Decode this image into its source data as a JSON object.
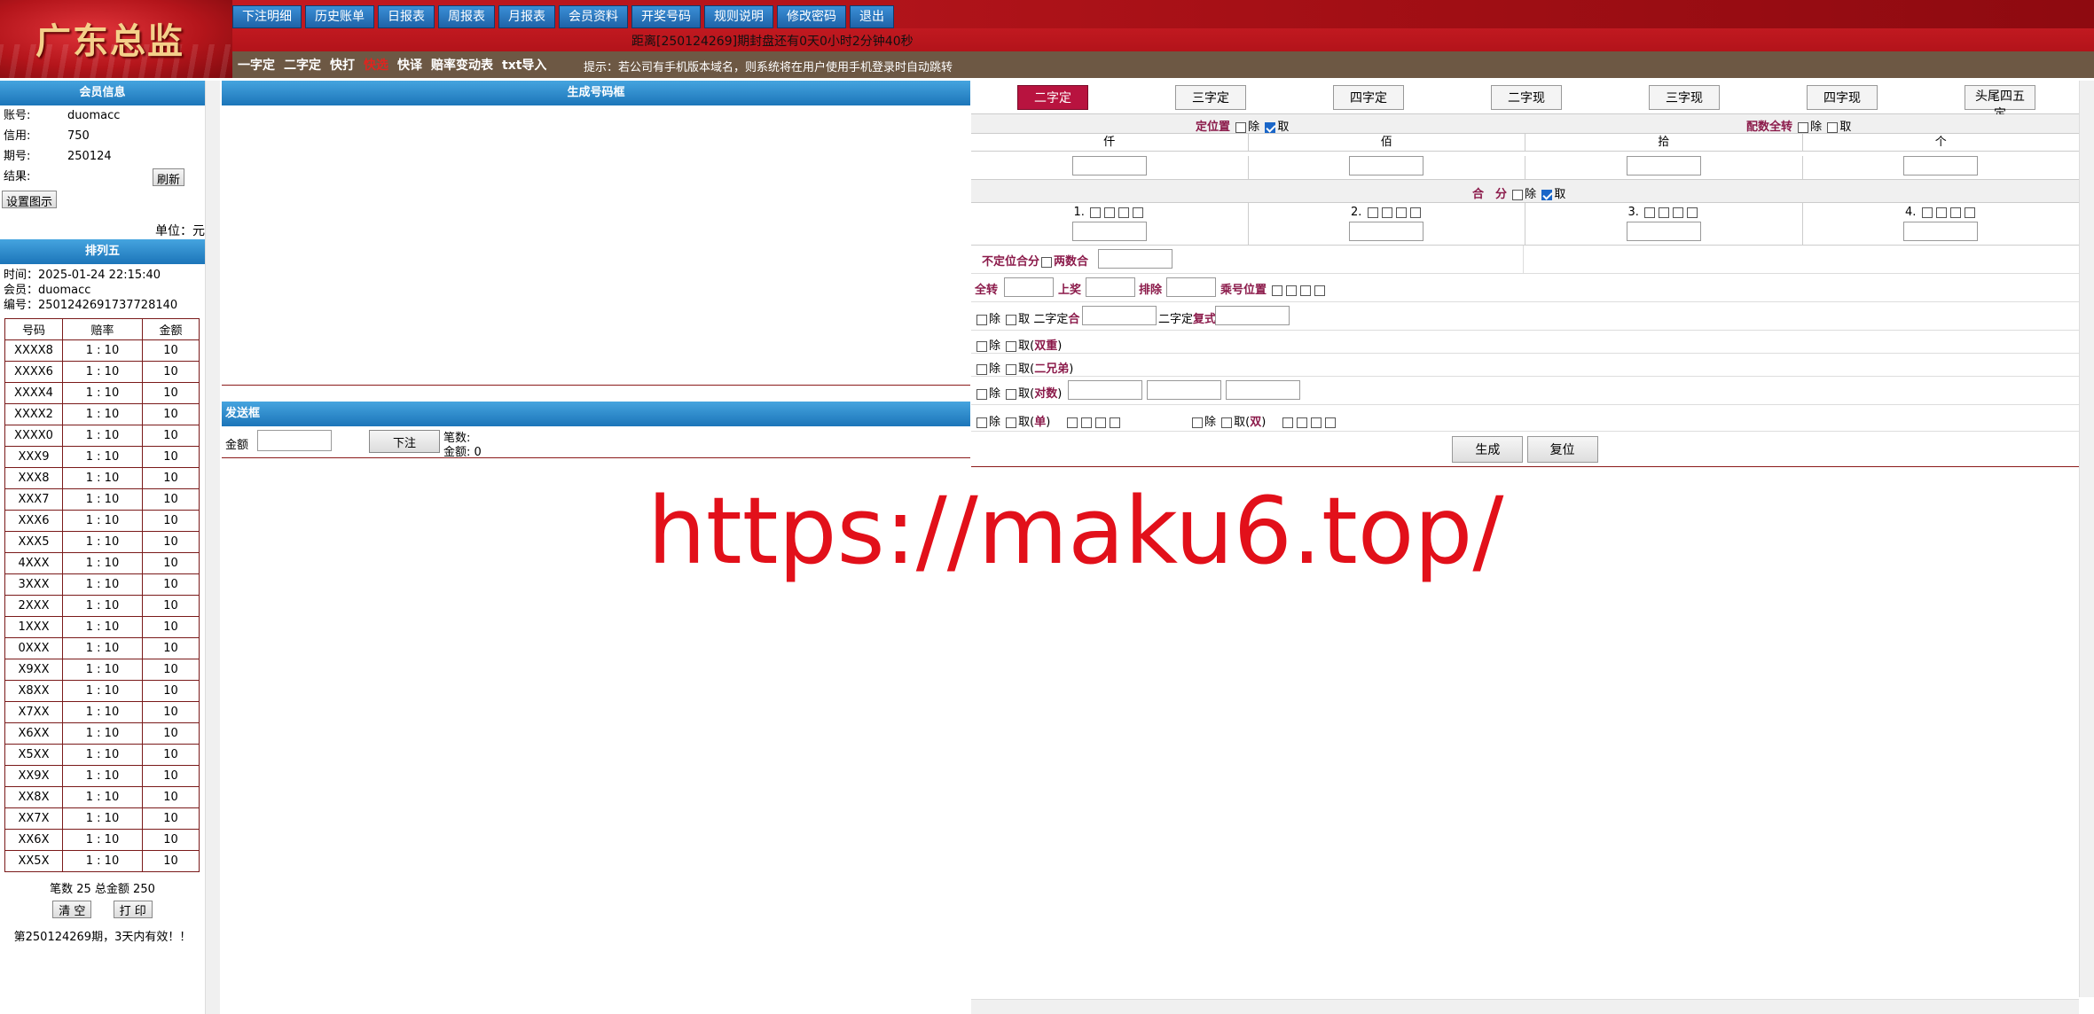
{
  "header": {
    "logo": "广东总监",
    "nav": [
      "下注明细",
      "历史账单",
      "日报表",
      "周报表",
      "月报表",
      "会员资料",
      "开奖号码",
      "规则说明",
      "修改密码",
      "退出"
    ],
    "countdown": "距离[250124269]期封盘还有0天0小时2分钟40秒",
    "subnav": [
      {
        "label": "一字定",
        "active": false
      },
      {
        "label": "二字定",
        "active": false
      },
      {
        "label": "快打",
        "active": false
      },
      {
        "label": "快选",
        "active": true
      },
      {
        "label": "快译",
        "active": false
      },
      {
        "label": "赔率变动表",
        "active": false
      },
      {
        "label": "txt导入",
        "active": false
      }
    ],
    "tip": "提示：若公司有手机版本域名，则系统将在用户使用手机登录时自动跳转"
  },
  "member": {
    "title": "会员信息",
    "account_label": "账号:",
    "account": "duomacc",
    "credit_label": "信用:",
    "credit": "750",
    "period_label": "期号:",
    "period": "250124",
    "result_label": "结果:",
    "refresh": "刷新",
    "settings": "设置图示",
    "unit": "单位：元"
  },
  "order": {
    "title": "排列五",
    "time": "时间：2025-01-24 22:15:40",
    "member": "会员：duomacc",
    "number": "编号：2501242691737728140",
    "headers": [
      "号码",
      "赔率",
      "金额"
    ],
    "rows": [
      [
        "XXXX8",
        "1 : 10",
        "10"
      ],
      [
        "XXXX6",
        "1 : 10",
        "10"
      ],
      [
        "XXXX4",
        "1 : 10",
        "10"
      ],
      [
        "XXXX2",
        "1 : 10",
        "10"
      ],
      [
        "XXXX0",
        "1 : 10",
        "10"
      ],
      [
        "XXX9",
        "1 : 10",
        "10"
      ],
      [
        "XXX8",
        "1 : 10",
        "10"
      ],
      [
        "XXX7",
        "1 : 10",
        "10"
      ],
      [
        "XXX6",
        "1 : 10",
        "10"
      ],
      [
        "XXX5",
        "1 : 10",
        "10"
      ],
      [
        "4XXX",
        "1 : 10",
        "10"
      ],
      [
        "3XXX",
        "1 : 10",
        "10"
      ],
      [
        "2XXX",
        "1 : 10",
        "10"
      ],
      [
        "1XXX",
        "1 : 10",
        "10"
      ],
      [
        "0XXX",
        "1 : 10",
        "10"
      ],
      [
        "X9XX",
        "1 : 10",
        "10"
      ],
      [
        "X8XX",
        "1 : 10",
        "10"
      ],
      [
        "X7XX",
        "1 : 10",
        "10"
      ],
      [
        "X6XX",
        "1 : 10",
        "10"
      ],
      [
        "X5XX",
        "1 : 10",
        "10"
      ],
      [
        "XX9X",
        "1 : 10",
        "10"
      ],
      [
        "XX8X",
        "1 : 10",
        "10"
      ],
      [
        "XX7X",
        "1 : 10",
        "10"
      ],
      [
        "XX6X",
        "1 : 10",
        "10"
      ],
      [
        "XX5X",
        "1 : 10",
        "10"
      ]
    ],
    "summary": "笔数 25 总金额 250",
    "clear": "清 空",
    "print": "打 印",
    "valid": "第250124269期，3天内有效！！"
  },
  "generator": {
    "title": "生成号码框"
  },
  "send": {
    "title": "发送框",
    "amount_label": "金额",
    "bet_button": "下注",
    "count": "笔数:",
    "total": "金额: 0"
  },
  "rules": {
    "tabs": [
      {
        "label": "二字定",
        "active": true
      },
      {
        "label": "三字定",
        "active": false
      },
      {
        "label": "四字定",
        "active": false
      },
      {
        "label": "二字现",
        "active": false
      },
      {
        "label": "三字现",
        "active": false
      },
      {
        "label": "四字现",
        "active": false
      },
      {
        "label": "头尾四五定",
        "active": false
      }
    ],
    "position_title": "定位置",
    "exclude": "除",
    "take": "取",
    "full_title": "配数全转",
    "digits": [
      "仟",
      "佰",
      "拾",
      "个"
    ],
    "sum_title": "合　分",
    "sum_items": [
      "1.",
      "2.",
      "3.",
      "4."
    ],
    "nonpos_label": "不定位合分",
    "two_sum": "两数合",
    "quanzhuan": "全转",
    "shangjiang": "上奖",
    "paichu": "排除",
    "chenghao": "乘号位置",
    "erzi_he_a": "二字定",
    "he": "合",
    "erzi_he_b": "二字定",
    "fushi": "复式",
    "shuangchong": "双重",
    "erxiongdi": "二兄弟",
    "duishu": "对数",
    "dan": "单",
    "shuang": "双",
    "lparen": "(",
    "rparen": ")",
    "generate": "生成",
    "reset": "复位"
  },
  "watermark": "https://maku6.top/"
}
